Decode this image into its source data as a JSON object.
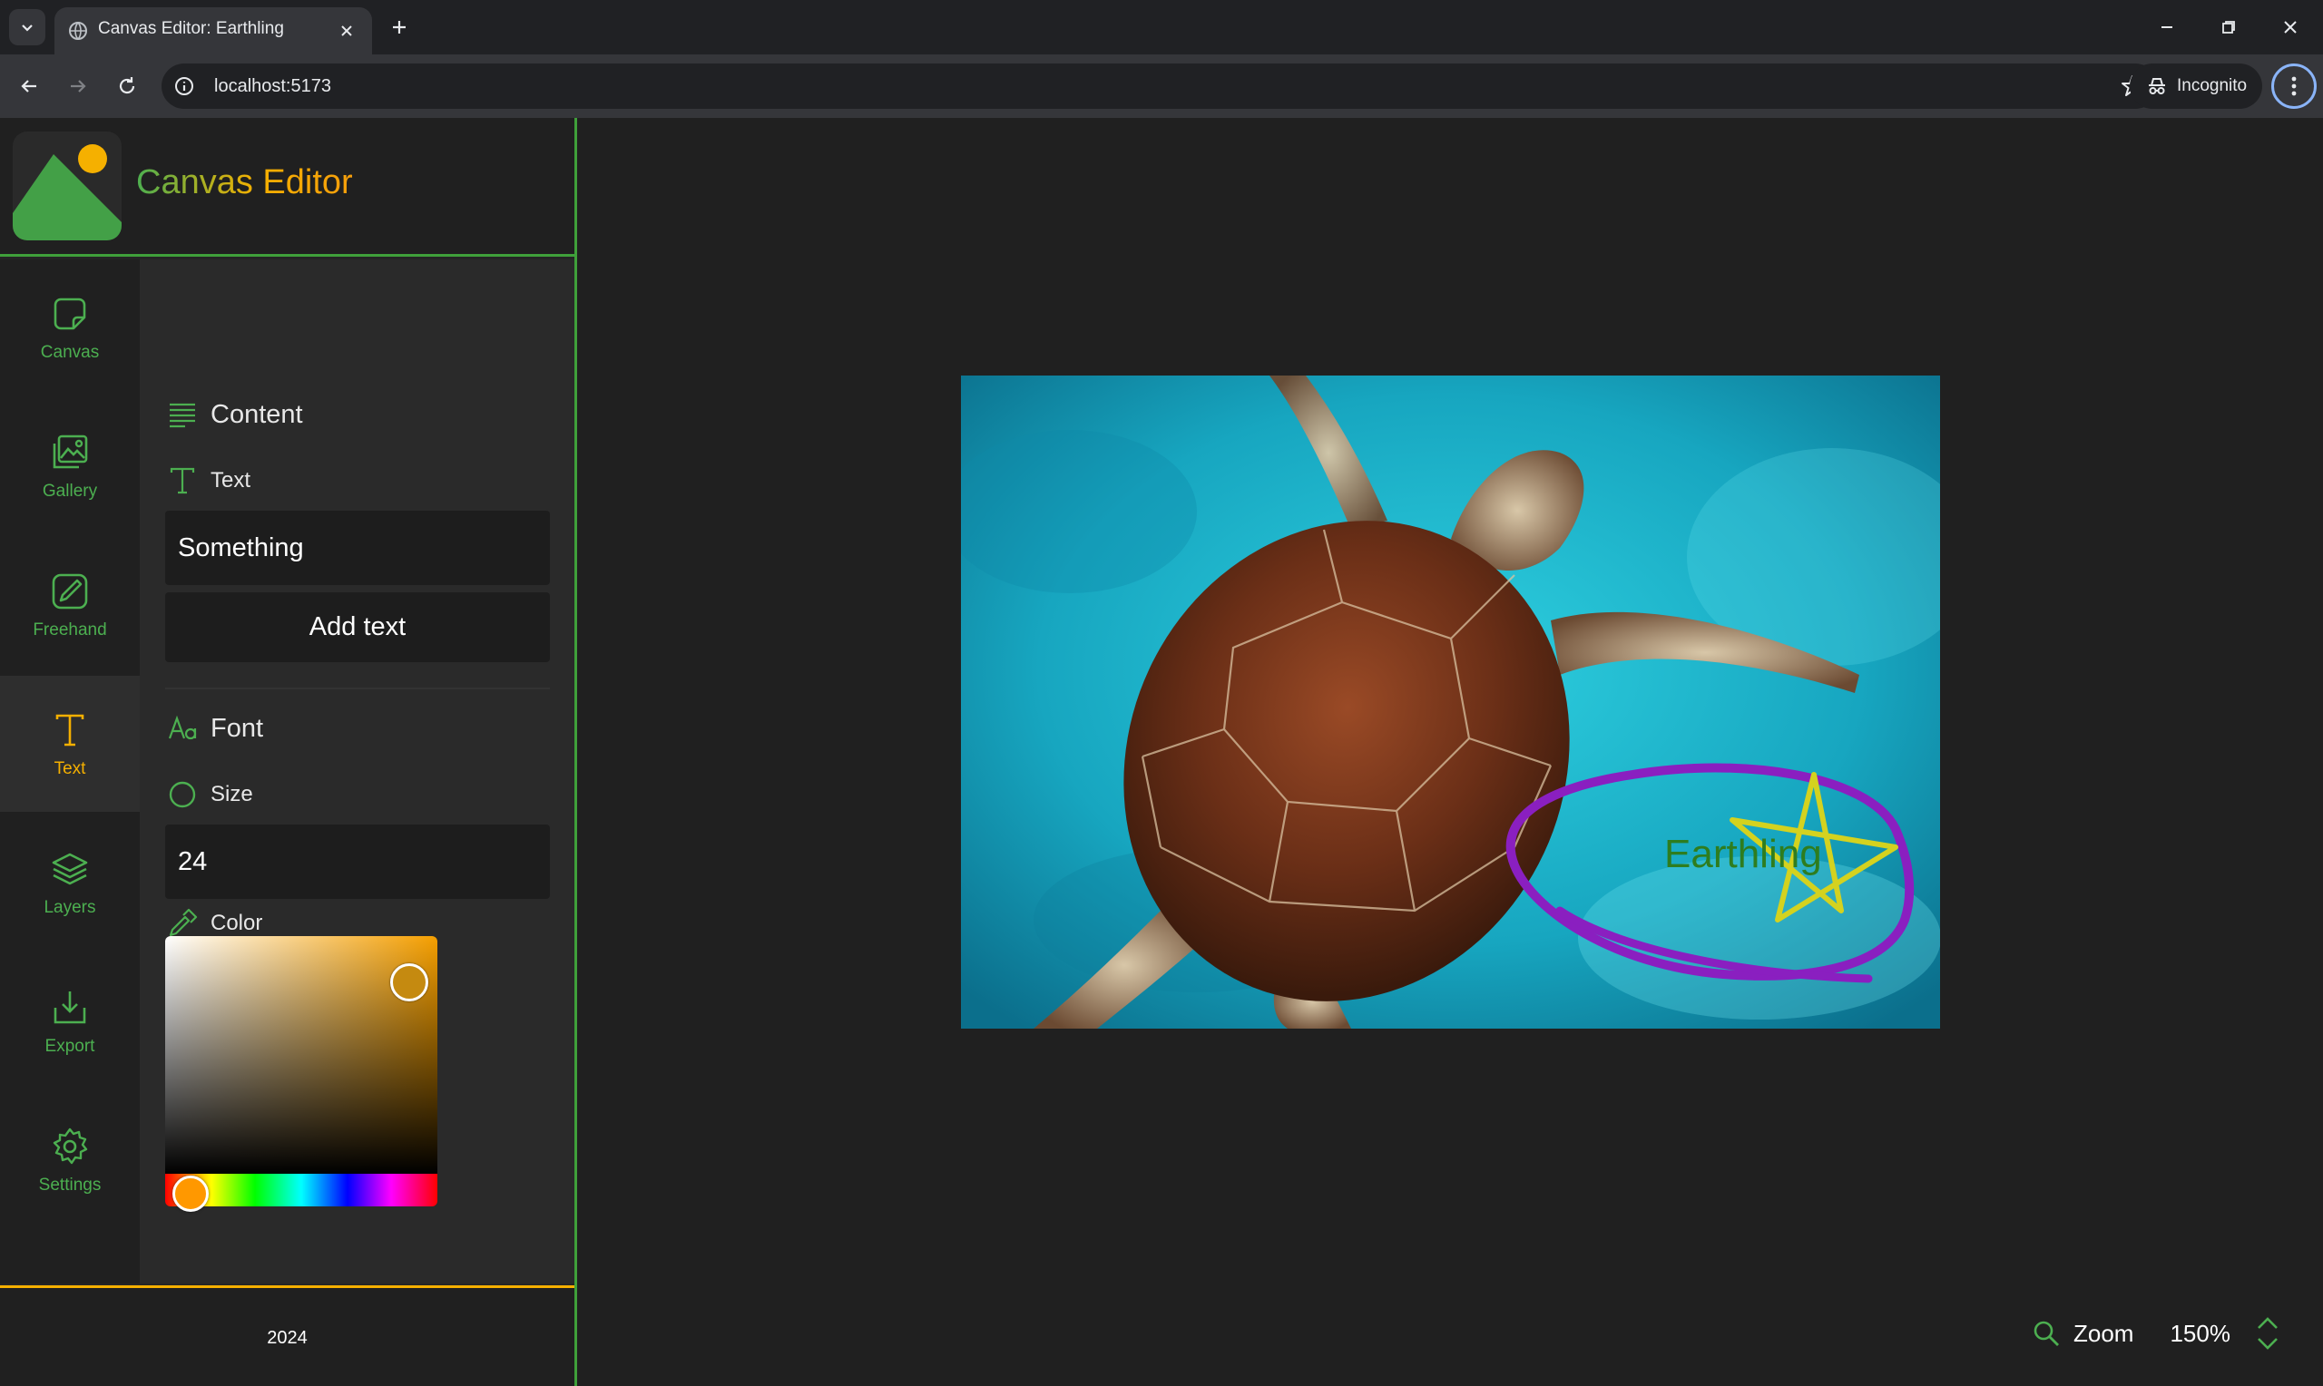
{
  "browser": {
    "tab_title": "Canvas Editor: Earthling",
    "url": "localhost:5173",
    "incognito_label": "Incognito"
  },
  "app": {
    "title": "Canvas Editor",
    "rail": [
      {
        "label": "Canvas",
        "icon": "canvas-icon"
      },
      {
        "label": "Gallery",
        "icon": "gallery-icon"
      },
      {
        "label": "Freehand",
        "icon": "freehand-icon"
      },
      {
        "label": "Text",
        "icon": "text-icon",
        "active": true
      },
      {
        "label": "Layers",
        "icon": "layers-icon"
      },
      {
        "label": "Export",
        "icon": "export-icon"
      },
      {
        "label": "Settings",
        "icon": "settings-icon"
      }
    ],
    "content": {
      "heading": "Content",
      "text_label": "Text",
      "text_value": "Something",
      "add_button": "Add text"
    },
    "font": {
      "heading": "Font",
      "size_label": "Size",
      "size_value": "24",
      "color_label": "Color",
      "selected_color": "#c58a10",
      "hue_color": "#f59f00"
    },
    "footer": "2024",
    "canvas": {
      "overlay_text": "Earthling",
      "overlay_text_color": "#2e7d1f",
      "ellipse_color": "#8a1fc0",
      "star_color": "#d4d21f"
    },
    "zoom": {
      "label": "Zoom",
      "value": "150%"
    }
  },
  "colors": {
    "accent_green": "#4caf50",
    "accent_orange": "#f5b000",
    "background": "#202020"
  }
}
